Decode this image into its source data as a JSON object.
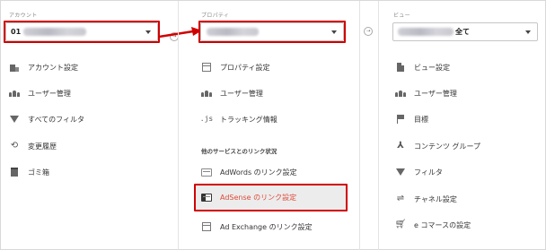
{
  "account": {
    "header": "アカウント",
    "selector_prefix": "01",
    "items": [
      {
        "label": "アカウント設定",
        "icon": "building-icon"
      },
      {
        "label": "ユーザー管理",
        "icon": "users-icon"
      },
      {
        "label": "すべてのフィルタ",
        "icon": "filter-icon"
      },
      {
        "label": "変更履歴",
        "icon": "history-icon"
      },
      {
        "label": "ゴミ箱",
        "icon": "trash-icon"
      }
    ]
  },
  "property": {
    "header": "プロパティ",
    "items": [
      {
        "label": "プロパティ設定",
        "icon": "property-icon"
      },
      {
        "label": "ユーザー管理",
        "icon": "users-icon"
      },
      {
        "label": "トラッキング情報",
        "icon": "js-icon",
        "icon_text": ".js"
      }
    ],
    "section_title": "他のサービスとのリンク状況",
    "links": [
      {
        "label": "AdWords のリンク設定",
        "icon": "adwords-icon"
      },
      {
        "label": "AdSense のリンク設定",
        "icon": "adsense-icon",
        "active": true
      },
      {
        "label": "Ad Exchange のリンク設定",
        "icon": "adexchange-icon"
      }
    ]
  },
  "view": {
    "header": "ビュー",
    "selector_suffix": "全て",
    "items": [
      {
        "label": "ビュー設定",
        "icon": "document-icon"
      },
      {
        "label": "ユーザー管理",
        "icon": "users-icon"
      },
      {
        "label": "目標",
        "icon": "flag-icon"
      },
      {
        "label": "コンテンツ グループ",
        "icon": "content-group-icon"
      },
      {
        "label": "フィルタ",
        "icon": "filter-icon"
      },
      {
        "label": "チャネル設定",
        "icon": "channel-icon"
      },
      {
        "label": "e コマースの設定",
        "icon": "cart-icon"
      }
    ]
  },
  "colors": {
    "highlight": "#d00000",
    "active_text": "#dd4b39",
    "active_bg": "#ececec"
  }
}
